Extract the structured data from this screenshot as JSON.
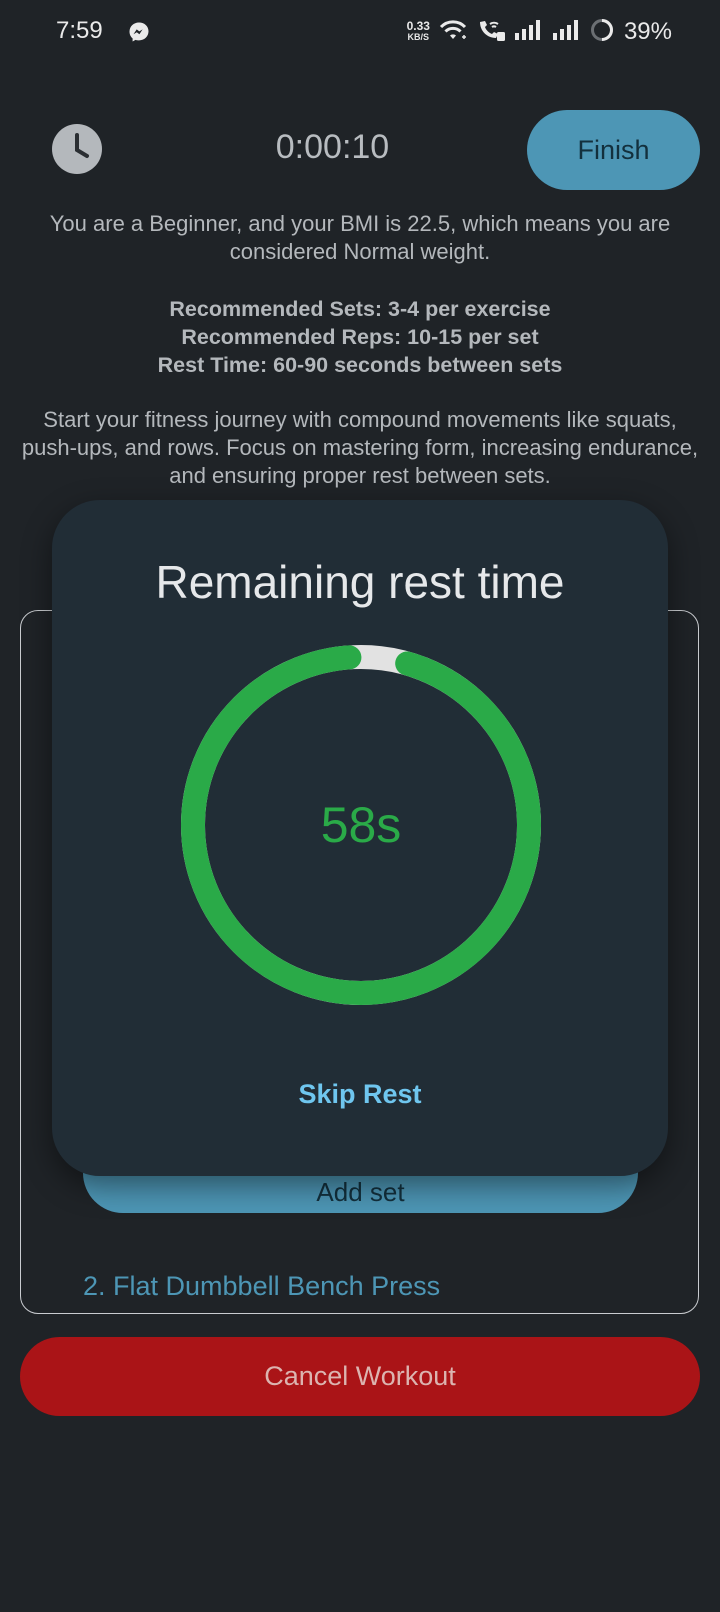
{
  "status_bar": {
    "time": "7:59",
    "net_speed_value": "0.33",
    "net_speed_unit": "KB/S",
    "battery": "39%",
    "icons": [
      "messenger-icon",
      "wifi-icon",
      "wifi-calling-icon",
      "signal-icon",
      "signal-icon",
      "battery-icon"
    ]
  },
  "header": {
    "elapsed_time": "0:00:10",
    "finish_label": "Finish"
  },
  "info": {
    "bmi_text": "You are a Beginner, and your BMI is 22.5, which means you are considered Normal weight.",
    "recommended_sets": "Recommended Sets: 3-4 per exercise",
    "recommended_reps": "Recommended Reps: 10-15 per set",
    "rest_time": "Rest Time: 60-90 seconds between sets",
    "journey_text": "Start your fitness journey with compound movements like squats, push-ups, and rows. Focus on mastering form, increasing endurance, and ensuring proper rest between sets."
  },
  "exercise_card": {
    "add_set_label": "Add set",
    "next_exercise": "2. Flat Dumbbell Bench Press"
  },
  "cancel_label": "Cancel Workout",
  "rest_dialog": {
    "title": "Remaining rest time",
    "remaining": "58s",
    "remaining_fraction": 0.967,
    "skip_label": "Skip Rest"
  },
  "colors": {
    "background": "#1f2327",
    "dialog_background": "#212d36",
    "accent_blue": "#4d96b5",
    "progress_green": "#2aaa48",
    "cancel_red": "#aa1417",
    "skip_text": "#6fc6ef"
  }
}
